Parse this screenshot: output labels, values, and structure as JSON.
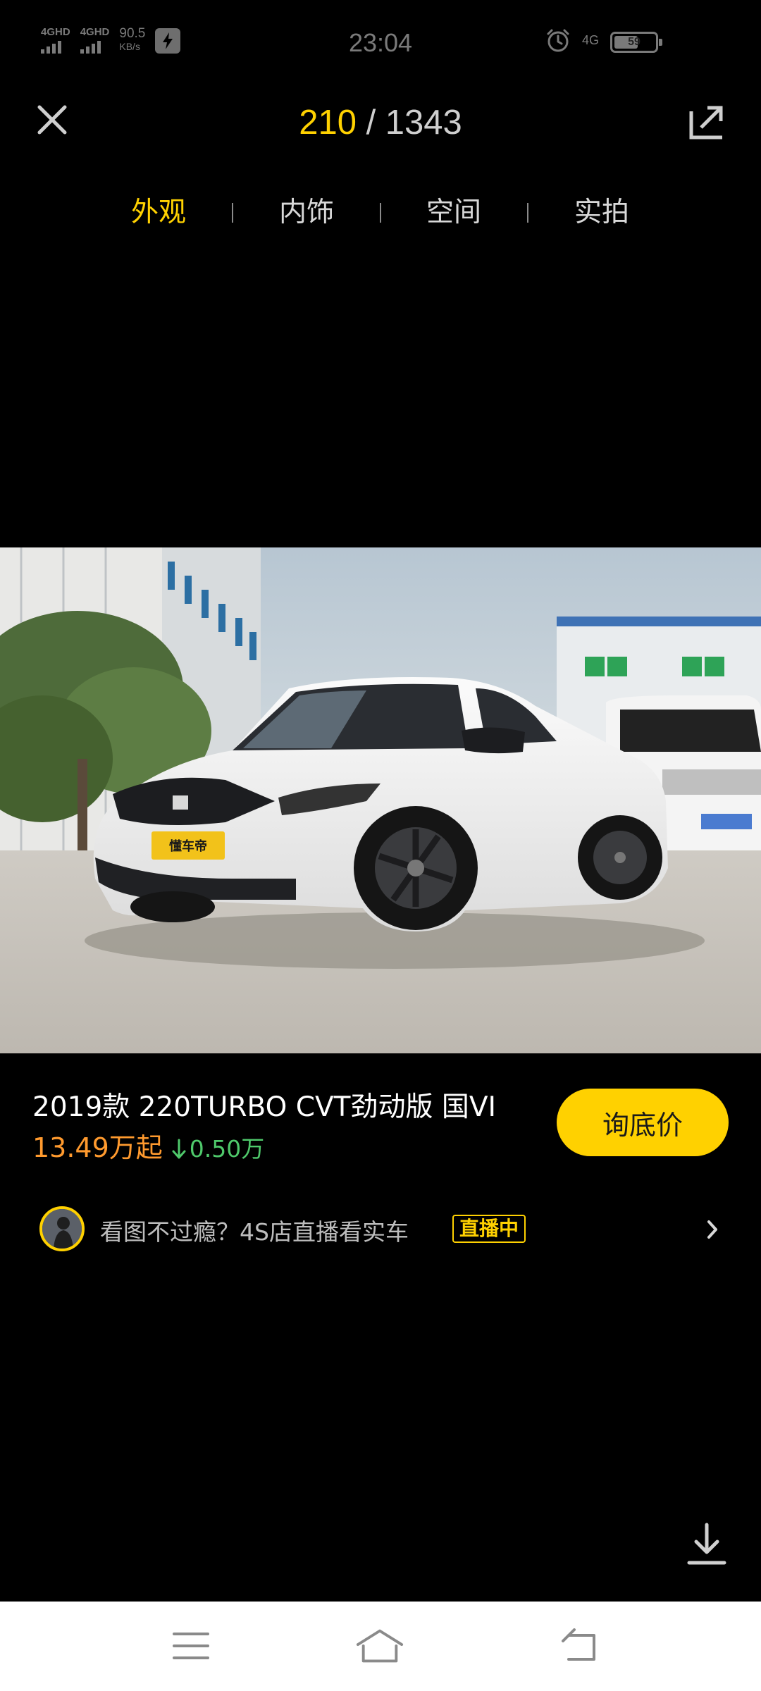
{
  "status_bar": {
    "signal1_label": "4GHD",
    "signal2_label": "4GHD",
    "net_speed": "90.5",
    "net_speed_unit": "KB/s",
    "time": "23:04",
    "network_type": "4G",
    "battery_level": "59",
    "icons": [
      "signal-icon",
      "flash-icon",
      "alarm-icon",
      "battery-icon"
    ]
  },
  "header": {
    "current_index": "210",
    "separator": " / ",
    "total": "1343"
  },
  "tabs": [
    {
      "label": "外观",
      "active": true
    },
    {
      "label": "内饰",
      "active": false
    },
    {
      "label": "空间",
      "active": false
    },
    {
      "label": "实拍",
      "active": false
    }
  ],
  "photo": {
    "watermark": "懂车帝"
  },
  "car": {
    "title": "2019款 220TURBO CVT劲动版 国VI",
    "price": "13.49万起",
    "price_drop": "0.50万",
    "inquiry_label": "询底价"
  },
  "live": {
    "text": "看图不过瘾？4S店直播看实车",
    "badge": "直播中"
  },
  "colors": {
    "accent": "#ffd100",
    "price": "#ff9a2e",
    "drop": "#4fc96b"
  }
}
